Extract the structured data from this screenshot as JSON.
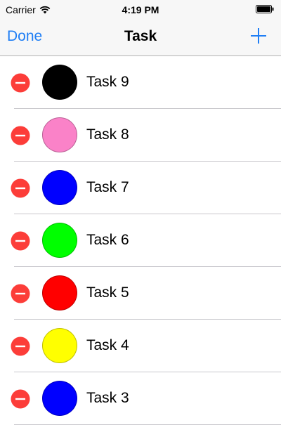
{
  "status_bar": {
    "carrier": "Carrier",
    "time": "4:19 PM",
    "icons": [
      "wifi-icon",
      "battery-icon"
    ]
  },
  "nav": {
    "left_button": "Done",
    "title": "Task",
    "right_icon": "add-icon"
  },
  "colors": {
    "accent": "#1f7ef5",
    "delete": "#fc3d39"
  },
  "tasks": [
    {
      "label": "Task 9",
      "color": "#000000"
    },
    {
      "label": "Task 8",
      "color": "#fa82c8"
    },
    {
      "label": "Task 7",
      "color": "#0000ff"
    },
    {
      "label": "Task 6",
      "color": "#00ff00"
    },
    {
      "label": "Task 5",
      "color": "#ff0000"
    },
    {
      "label": "Task 4",
      "color": "#ffff00"
    },
    {
      "label": "Task 3",
      "color": "#0000ff"
    }
  ]
}
